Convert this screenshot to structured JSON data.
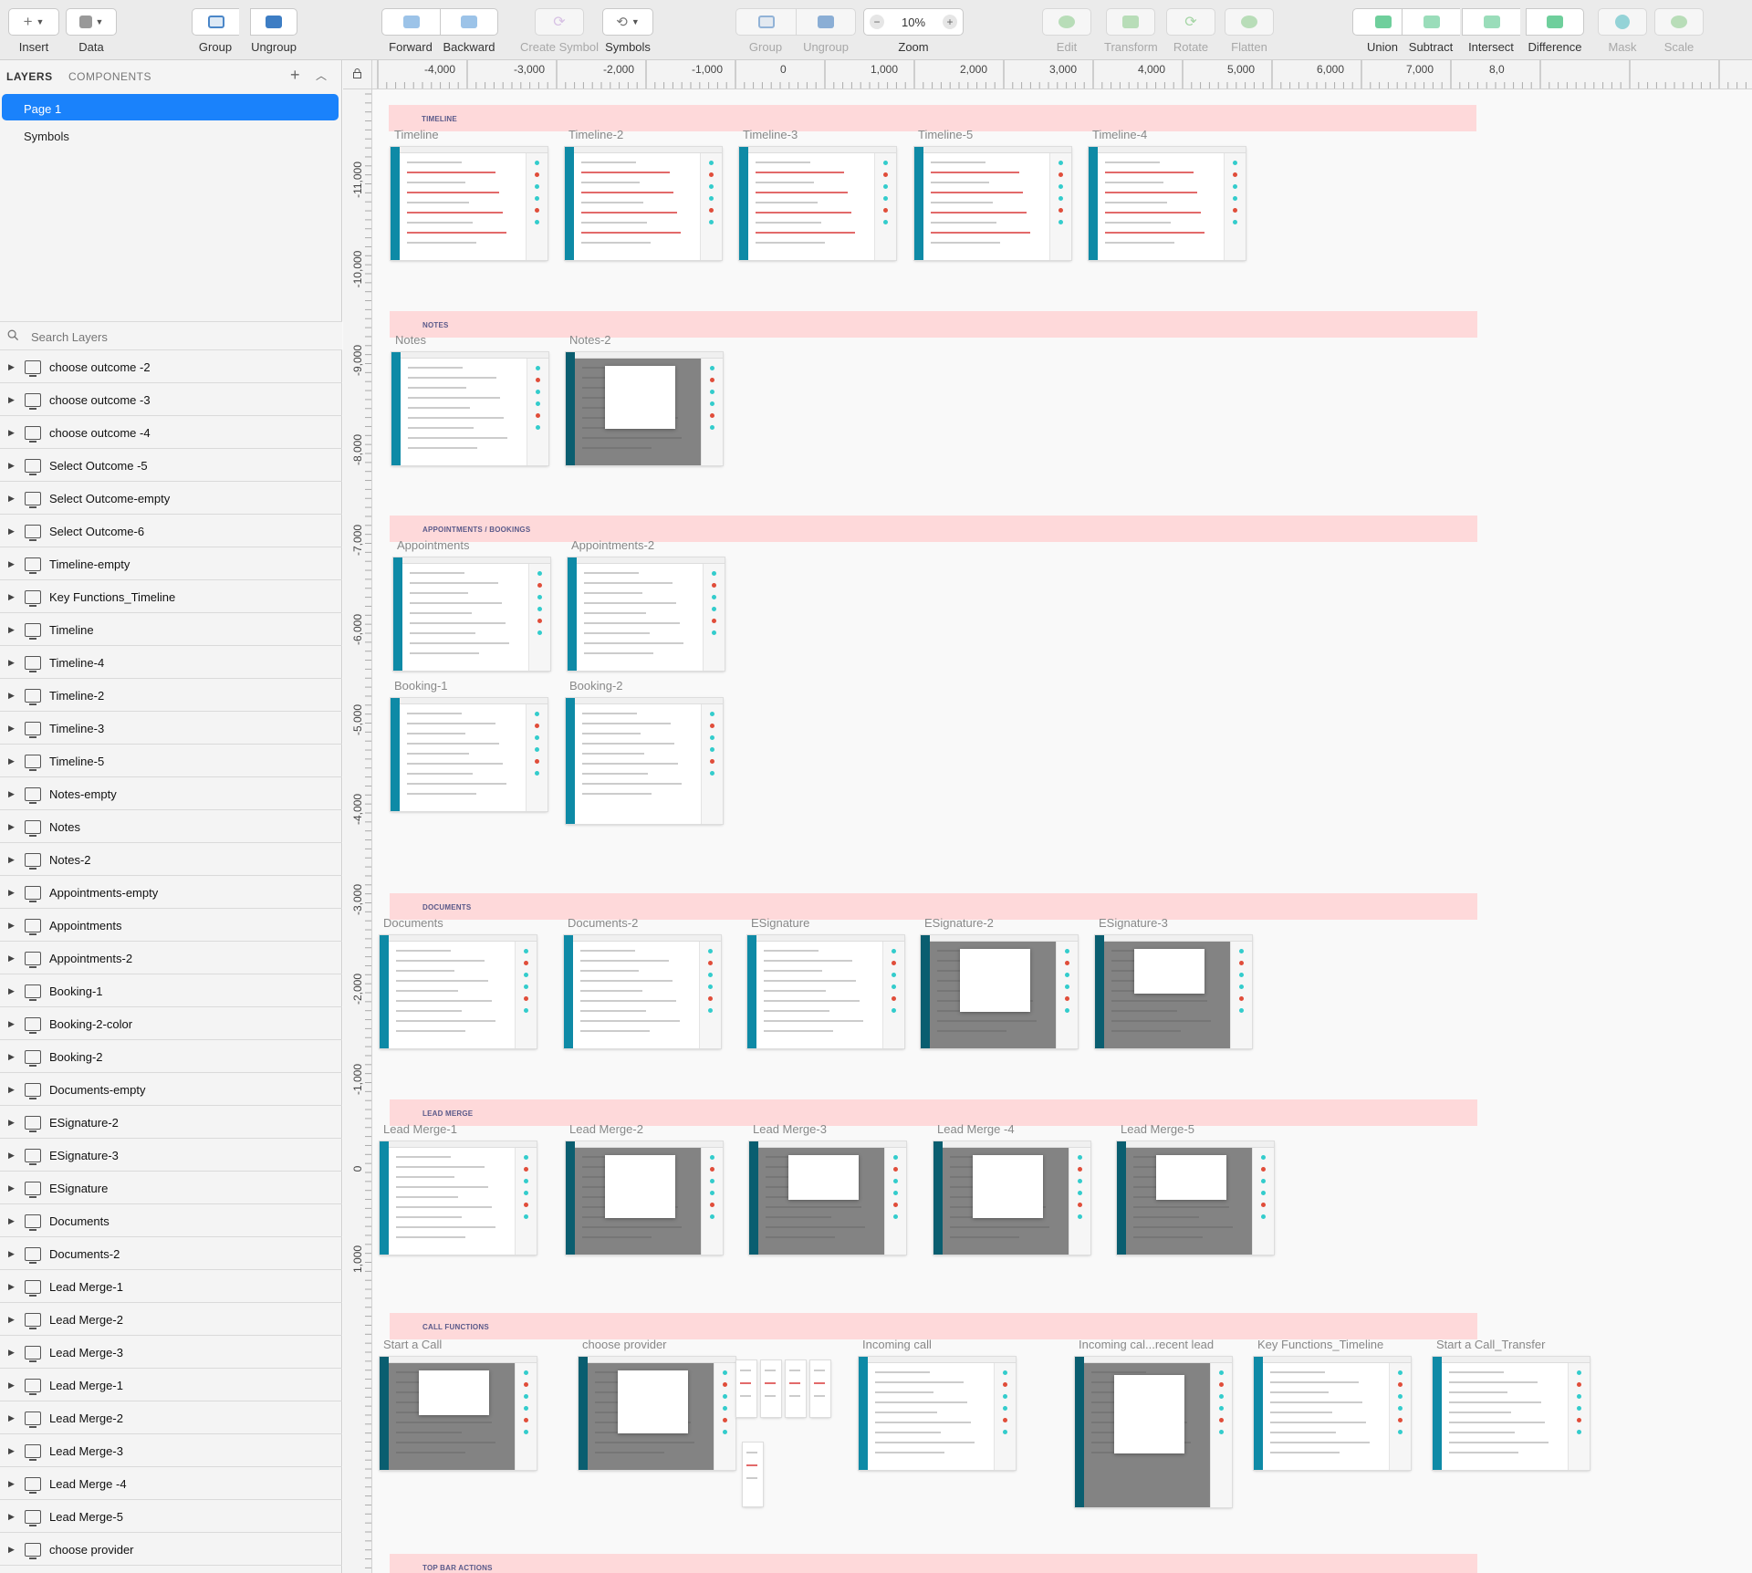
{
  "toolbar": {
    "insert": "Insert",
    "data": "Data",
    "group": "Group",
    "ungroup": "Ungroup",
    "forward": "Forward",
    "backward": "Backward",
    "create_symbol": "Create Symbol",
    "symbols": "Symbols",
    "group2": "Group",
    "ungroup2": "Ungroup",
    "zoom_label": "Zoom",
    "zoom_value": "10%",
    "zoom_minus": "−",
    "zoom_plus": "+",
    "edit": "Edit",
    "transform": "Transform",
    "rotate": "Rotate",
    "flatten": "Flatten",
    "union": "Union",
    "subtract": "Subtract",
    "intersect": "Intersect",
    "difference": "Difference",
    "mask": "Mask",
    "scale": "Scale",
    "insert_plus": "+"
  },
  "panel": {
    "tab_layers": "LAYERS",
    "tab_components": "COMPONENTS",
    "add": "+",
    "collapse": "︿",
    "pages": [
      "Page 1",
      "Symbols"
    ],
    "search_placeholder": "Search Layers",
    "layers": [
      "choose outcome -2",
      "choose outcome -3",
      "choose outcome -4",
      "Select Outcome -5",
      "Select Outcome-empty",
      "Select Outcome-6",
      "Timeline-empty",
      "Key Functions_Timeline",
      "Timeline",
      "Timeline-4",
      "Timeline-2",
      "Timeline-3",
      "Timeline-5",
      "Notes-empty",
      "Notes",
      "Notes-2",
      "Appointments-empty",
      "Appointments",
      "Appointments-2",
      "Booking-1",
      "Booking-2-color",
      "Booking-2",
      "Documents-empty",
      "ESignature-2",
      "ESignature-3",
      "ESignature",
      "Documents",
      "Documents-2",
      "Lead Merge-1",
      "Lead Merge-2",
      "Lead Merge-3",
      "Lead Merge-1",
      "Lead Merge-2",
      "Lead Merge-3",
      "Lead Merge -4",
      "Lead Merge-5",
      "choose provider"
    ]
  },
  "ruler": {
    "top": [
      "-4,000",
      "-3,000",
      "-2,000",
      "-1,000",
      "0",
      "1,000",
      "2,000",
      "3,000",
      "4,000",
      "5,000",
      "6,000",
      "7,000",
      "8,0"
    ],
    "left": [
      "-11,000",
      "-10,000",
      "-9,000",
      "-8,000",
      "-7,000",
      "-6,000",
      "-5,000",
      "-4,000",
      "-3,000",
      "-2,000",
      "-1,000",
      "0",
      "1,000"
    ]
  },
  "sections": [
    {
      "title": "TIMELINE",
      "artboards": [
        "Timeline",
        "Timeline-2",
        "Timeline-3",
        "Timeline-5",
        "Timeline-4"
      ]
    },
    {
      "title": "NOTES",
      "artboards": [
        "Notes",
        "Notes-2"
      ]
    },
    {
      "title": "APPOINTMENTS / BOOKINGS",
      "artboards": [
        "Appointments",
        "Appointments-2",
        "Booking-1",
        "Booking-2"
      ]
    },
    {
      "title": "DOCUMENTS",
      "artboards": [
        "Documents",
        "Documents-2",
        "ESignature",
        "ESignature-2",
        "ESignature-3"
      ]
    },
    {
      "title": "LEAD MERGE",
      "artboards": [
        "Lead Merge-1",
        "Lead Merge-2",
        "Lead Merge-3",
        "Lead Merge -4",
        "Lead Merge-5"
      ]
    },
    {
      "title": "CALL FUNCTIONS",
      "artboards": [
        "Start a Call",
        "choose provider",
        "Incoming call",
        "Incoming cal...recent lead",
        "Key Functions_Timeline",
        "Start a Call_Transfer"
      ]
    },
    {
      "title": "TOP BAR ACTIONS",
      "artboards": []
    }
  ],
  "colors": {
    "accent": "#1a82fb",
    "section_bg": "#fed9da",
    "app_teal": "#0e8aa6",
    "danger": "#e04d3a"
  }
}
